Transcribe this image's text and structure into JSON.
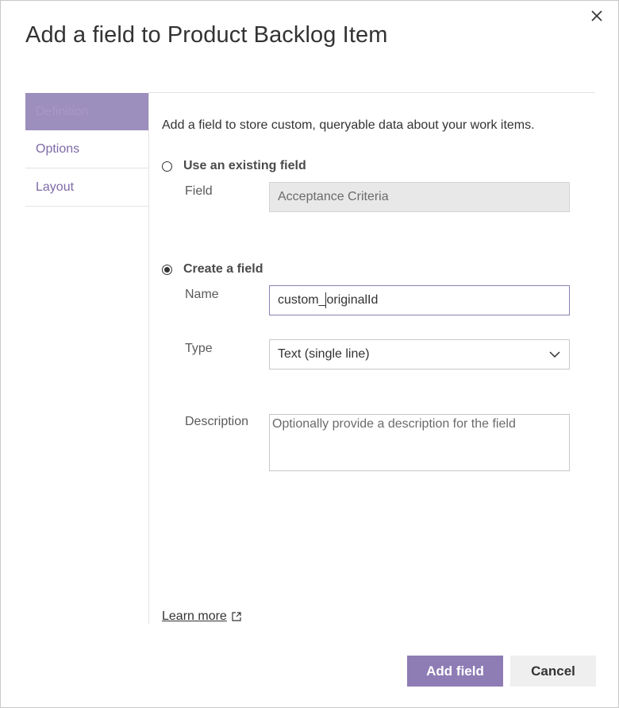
{
  "dialog": {
    "title": "Add a field to Product Backlog Item"
  },
  "nav": {
    "items": [
      {
        "label": "Definition"
      },
      {
        "label": "Options"
      },
      {
        "label": "Layout"
      }
    ]
  },
  "content": {
    "intro": "Add a field to store custom, queryable data about your work items.",
    "existing": {
      "radio_label": "Use an existing field",
      "field_label": "Field",
      "field_value": "Acceptance Criteria"
    },
    "create": {
      "radio_label": "Create a field",
      "name_label": "Name",
      "name_value_before_caret": "custom_",
      "name_value_after_caret": "originalId",
      "type_label": "Type",
      "type_value": "Text (single line)",
      "description_label": "Description",
      "description_placeholder": "Optionally provide a description for the field"
    },
    "learn_more": "Learn more"
  },
  "footer": {
    "primary_label": "Add field",
    "cancel_label": "Cancel"
  },
  "colors": {
    "accent": "#8e7cb5",
    "nav_selected": "#9c8ebd",
    "link": "#7e6aa6"
  },
  "icons": {
    "close": "close-icon",
    "chevron": "chevron-down-icon",
    "external": "external-link-icon"
  }
}
